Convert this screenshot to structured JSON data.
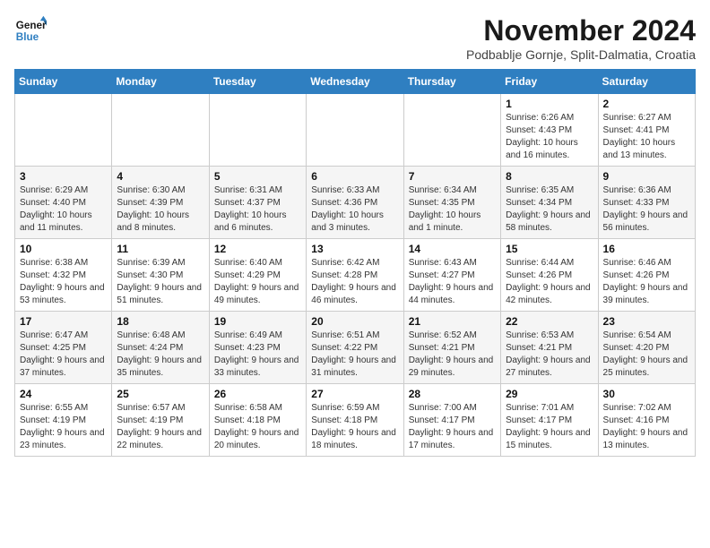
{
  "logo": {
    "line1": "General",
    "line2": "Blue"
  },
  "title": "November 2024",
  "location": "Podbablje Gornje, Split-Dalmatia, Croatia",
  "weekdays": [
    "Sunday",
    "Monday",
    "Tuesday",
    "Wednesday",
    "Thursday",
    "Friday",
    "Saturday"
  ],
  "weeks": [
    [
      {
        "day": "",
        "info": ""
      },
      {
        "day": "",
        "info": ""
      },
      {
        "day": "",
        "info": ""
      },
      {
        "day": "",
        "info": ""
      },
      {
        "day": "",
        "info": ""
      },
      {
        "day": "1",
        "info": "Sunrise: 6:26 AM\nSunset: 4:43 PM\nDaylight: 10 hours and 16 minutes."
      },
      {
        "day": "2",
        "info": "Sunrise: 6:27 AM\nSunset: 4:41 PM\nDaylight: 10 hours and 13 minutes."
      }
    ],
    [
      {
        "day": "3",
        "info": "Sunrise: 6:29 AM\nSunset: 4:40 PM\nDaylight: 10 hours and 11 minutes."
      },
      {
        "day": "4",
        "info": "Sunrise: 6:30 AM\nSunset: 4:39 PM\nDaylight: 10 hours and 8 minutes."
      },
      {
        "day": "5",
        "info": "Sunrise: 6:31 AM\nSunset: 4:37 PM\nDaylight: 10 hours and 6 minutes."
      },
      {
        "day": "6",
        "info": "Sunrise: 6:33 AM\nSunset: 4:36 PM\nDaylight: 10 hours and 3 minutes."
      },
      {
        "day": "7",
        "info": "Sunrise: 6:34 AM\nSunset: 4:35 PM\nDaylight: 10 hours and 1 minute."
      },
      {
        "day": "8",
        "info": "Sunrise: 6:35 AM\nSunset: 4:34 PM\nDaylight: 9 hours and 58 minutes."
      },
      {
        "day": "9",
        "info": "Sunrise: 6:36 AM\nSunset: 4:33 PM\nDaylight: 9 hours and 56 minutes."
      }
    ],
    [
      {
        "day": "10",
        "info": "Sunrise: 6:38 AM\nSunset: 4:32 PM\nDaylight: 9 hours and 53 minutes."
      },
      {
        "day": "11",
        "info": "Sunrise: 6:39 AM\nSunset: 4:30 PM\nDaylight: 9 hours and 51 minutes."
      },
      {
        "day": "12",
        "info": "Sunrise: 6:40 AM\nSunset: 4:29 PM\nDaylight: 9 hours and 49 minutes."
      },
      {
        "day": "13",
        "info": "Sunrise: 6:42 AM\nSunset: 4:28 PM\nDaylight: 9 hours and 46 minutes."
      },
      {
        "day": "14",
        "info": "Sunrise: 6:43 AM\nSunset: 4:27 PM\nDaylight: 9 hours and 44 minutes."
      },
      {
        "day": "15",
        "info": "Sunrise: 6:44 AM\nSunset: 4:26 PM\nDaylight: 9 hours and 42 minutes."
      },
      {
        "day": "16",
        "info": "Sunrise: 6:46 AM\nSunset: 4:26 PM\nDaylight: 9 hours and 39 minutes."
      }
    ],
    [
      {
        "day": "17",
        "info": "Sunrise: 6:47 AM\nSunset: 4:25 PM\nDaylight: 9 hours and 37 minutes."
      },
      {
        "day": "18",
        "info": "Sunrise: 6:48 AM\nSunset: 4:24 PM\nDaylight: 9 hours and 35 minutes."
      },
      {
        "day": "19",
        "info": "Sunrise: 6:49 AM\nSunset: 4:23 PM\nDaylight: 9 hours and 33 minutes."
      },
      {
        "day": "20",
        "info": "Sunrise: 6:51 AM\nSunset: 4:22 PM\nDaylight: 9 hours and 31 minutes."
      },
      {
        "day": "21",
        "info": "Sunrise: 6:52 AM\nSunset: 4:21 PM\nDaylight: 9 hours and 29 minutes."
      },
      {
        "day": "22",
        "info": "Sunrise: 6:53 AM\nSunset: 4:21 PM\nDaylight: 9 hours and 27 minutes."
      },
      {
        "day": "23",
        "info": "Sunrise: 6:54 AM\nSunset: 4:20 PM\nDaylight: 9 hours and 25 minutes."
      }
    ],
    [
      {
        "day": "24",
        "info": "Sunrise: 6:55 AM\nSunset: 4:19 PM\nDaylight: 9 hours and 23 minutes."
      },
      {
        "day": "25",
        "info": "Sunrise: 6:57 AM\nSunset: 4:19 PM\nDaylight: 9 hours and 22 minutes."
      },
      {
        "day": "26",
        "info": "Sunrise: 6:58 AM\nSunset: 4:18 PM\nDaylight: 9 hours and 20 minutes."
      },
      {
        "day": "27",
        "info": "Sunrise: 6:59 AM\nSunset: 4:18 PM\nDaylight: 9 hours and 18 minutes."
      },
      {
        "day": "28",
        "info": "Sunrise: 7:00 AM\nSunset: 4:17 PM\nDaylight: 9 hours and 17 minutes."
      },
      {
        "day": "29",
        "info": "Sunrise: 7:01 AM\nSunset: 4:17 PM\nDaylight: 9 hours and 15 minutes."
      },
      {
        "day": "30",
        "info": "Sunrise: 7:02 AM\nSunset: 4:16 PM\nDaylight: 9 hours and 13 minutes."
      }
    ]
  ]
}
